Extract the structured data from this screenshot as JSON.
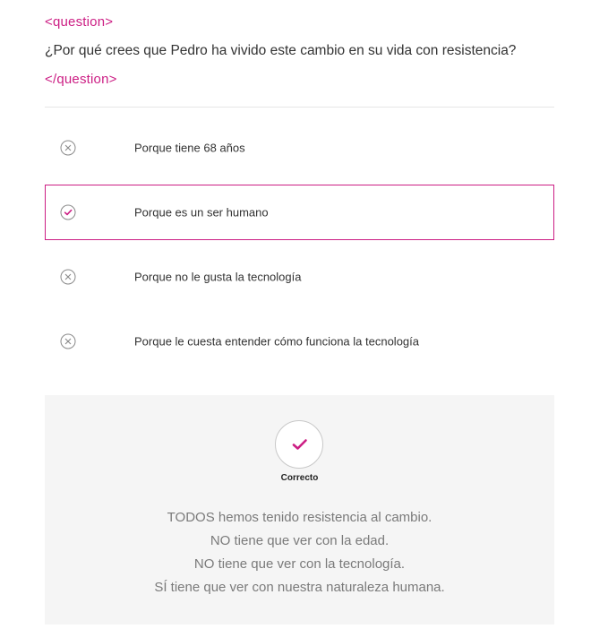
{
  "question": {
    "open_tag": "<question>",
    "text": "¿Por qué crees que Pedro ha vivido este cambio en su vida con resistencia?",
    "close_tag": "</question>"
  },
  "options": [
    {
      "label": "Porque tiene 68 años",
      "state": "incorrect",
      "icon": "x-circle-icon"
    },
    {
      "label": "Porque es un ser humano",
      "state": "selected-correct",
      "icon": "check-circle-icon"
    },
    {
      "label": "Porque no le gusta la tecnología",
      "state": "incorrect",
      "icon": "x-circle-icon"
    },
    {
      "label": "Porque le cuesta entender cómo funciona la tecnología",
      "state": "incorrect",
      "icon": "x-circle-icon"
    }
  ],
  "feedback": {
    "status": "Correcto",
    "icon": "checkmark-icon",
    "lines": [
      "TODOS hemos tenido resistencia al cambio.",
      "NO tiene que ver con la edad.",
      "NO tiene que ver con la tecnología.",
      "SÍ tiene que ver con nuestra naturaleza humana."
    ]
  },
  "colors": {
    "accent": "#cc1e84",
    "icon_gray": "#8a8a8a",
    "feedback_bg": "#f5f5f5",
    "feedback_text": "#7a7a7a"
  }
}
